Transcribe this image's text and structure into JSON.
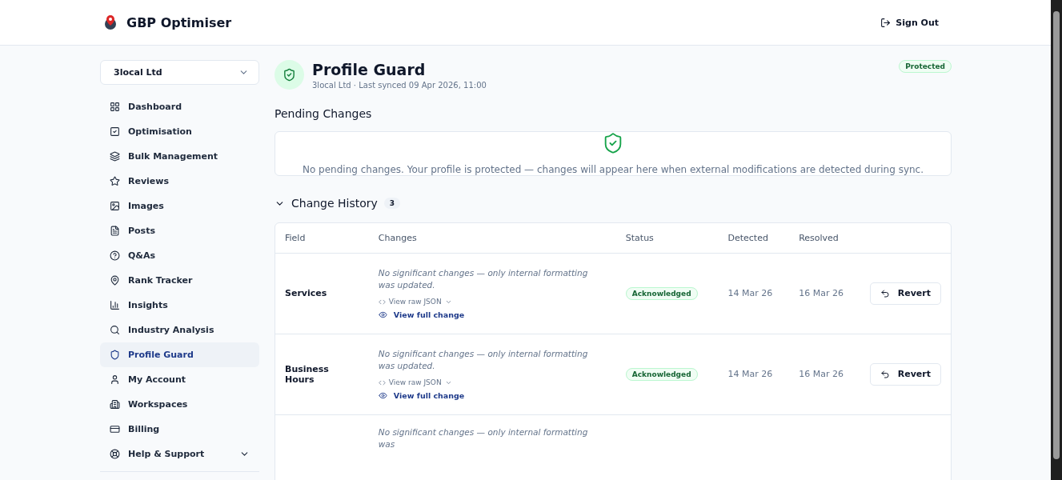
{
  "header": {
    "app_name": "GBP Optimiser",
    "sign_out": "Sign Out"
  },
  "sidebar": {
    "workspace_select": "3local Ltd",
    "items": [
      {
        "label": "Dashboard",
        "selected": false
      },
      {
        "label": "Optimisation",
        "selected": false
      },
      {
        "label": "Bulk Management",
        "selected": false
      },
      {
        "label": "Reviews",
        "selected": false
      },
      {
        "label": "Images",
        "selected": false
      },
      {
        "label": "Posts",
        "selected": false
      },
      {
        "label": "Q&As",
        "selected": false
      },
      {
        "label": "Rank Tracker",
        "selected": false
      },
      {
        "label": "Insights",
        "selected": false
      },
      {
        "label": "Industry Analysis",
        "selected": false
      },
      {
        "label": "Profile Guard",
        "selected": true
      },
      {
        "label": "My Account",
        "selected": false
      },
      {
        "label": "Workspaces",
        "selected": false
      },
      {
        "label": "Billing",
        "selected": false
      },
      {
        "label": "Help & Support",
        "selected": false,
        "expanded": false
      }
    ]
  },
  "page": {
    "title": "Profile Guard",
    "subtitle": "3local Ltd · Last synced 09 Apr 2026, 11:00",
    "status_badge": "Protected"
  },
  "pending": {
    "heading": "Pending Changes",
    "empty_message": "No pending changes. Your profile is protected — changes will appear here when external modifications are detected during sync."
  },
  "history": {
    "heading": "Change History",
    "count": "3",
    "expanded": true,
    "columns": [
      "Field",
      "Changes",
      "Status",
      "Detected",
      "Resolved"
    ],
    "rows": [
      {
        "field": "Services",
        "summary": "No significant changes — only internal formatting was updated.",
        "raw_link": "View raw JSON",
        "full_link": "View full change",
        "status": "Acknowledged",
        "detected": "14 Mar 26",
        "resolved": "16 Mar 26",
        "action": "Revert"
      },
      {
        "field": "Business Hours",
        "summary": "No significant changes — only internal formatting was updated.",
        "raw_link": "View raw JSON",
        "full_link": "View full change",
        "status": "Acknowledged",
        "detected": "14 Mar 26",
        "resolved": "16 Mar 26",
        "action": "Revert"
      },
      {
        "summary": "No significant changes — only internal formatting was"
      }
    ]
  }
}
